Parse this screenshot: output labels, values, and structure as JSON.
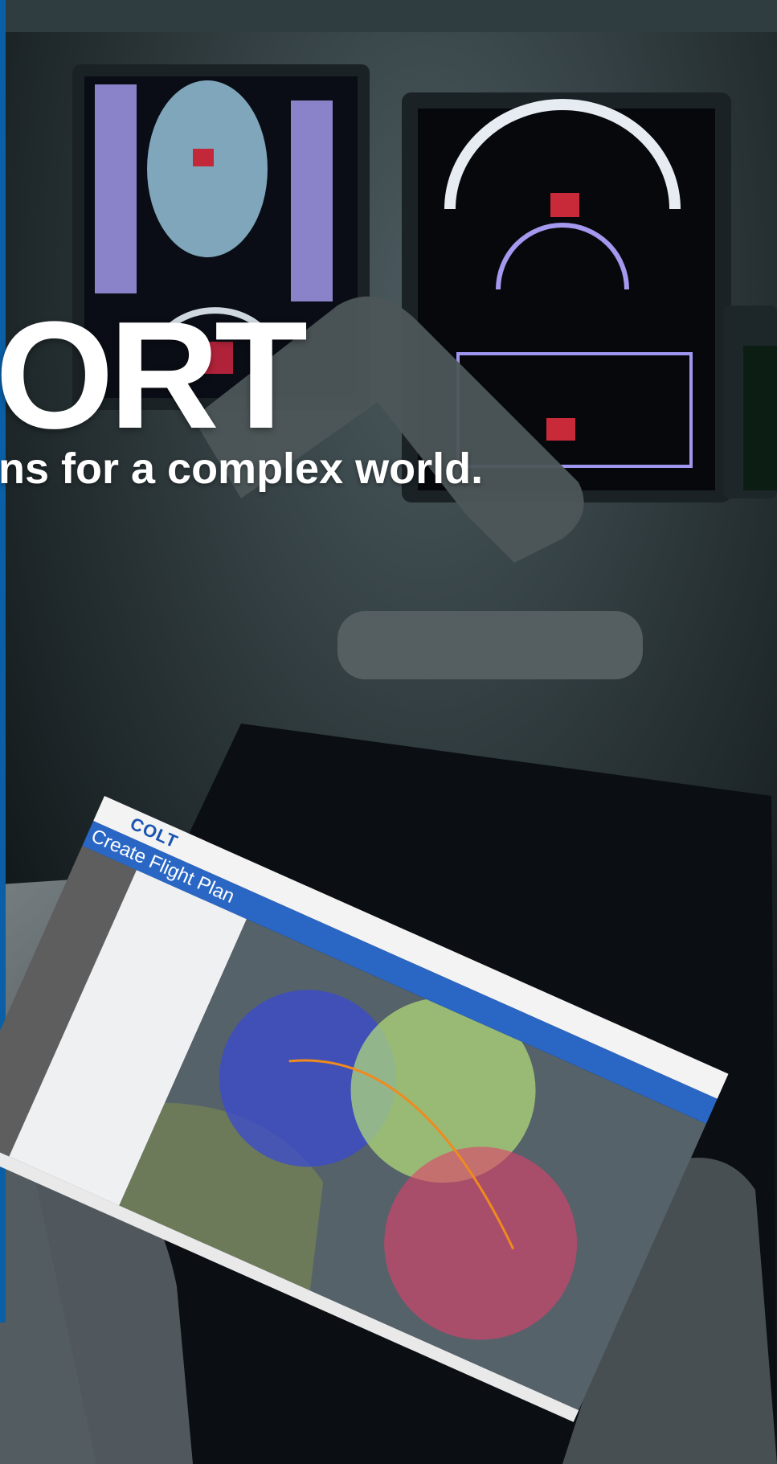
{
  "headline": "ORT",
  "tagline": "ns for a complex world.",
  "tablet_app": {
    "logo": "COLT",
    "page_title": "Create Flight Plan"
  },
  "colors": {
    "edge_bar": "#0b5fa6",
    "app_header_bar": "#2a67c5",
    "circle_blue": "#3a4bd0",
    "circle_green": "#b6e07a",
    "circle_red": "#e0406a",
    "route_line": "#f08a1e"
  }
}
